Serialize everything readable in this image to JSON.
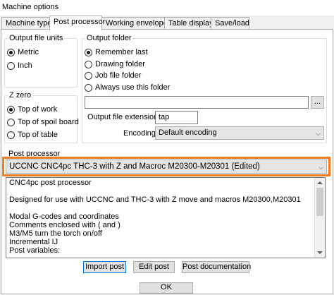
{
  "window": {
    "title": "Machine options"
  },
  "tabs": [
    {
      "label": "Machine type"
    },
    {
      "label": "Post processor"
    },
    {
      "label": "Working envelope"
    },
    {
      "label": "Table display"
    },
    {
      "label": "Save/load"
    }
  ],
  "output_units": {
    "legend": "Output file units",
    "options": [
      {
        "label": "Metric",
        "selected": true
      },
      {
        "label": "Inch",
        "selected": false
      }
    ]
  },
  "z_zero": {
    "legend": "Z zero",
    "options": [
      {
        "label": "Top of work",
        "selected": true
      },
      {
        "label": "Top of spoil board",
        "selected": false
      },
      {
        "label": "Top of table",
        "selected": false
      }
    ]
  },
  "output_folder": {
    "legend": "Output folder",
    "options": [
      {
        "label": "Remember last",
        "selected": true
      },
      {
        "label": "Drawing folder",
        "selected": false
      },
      {
        "label": "Job file folder",
        "selected": false
      },
      {
        "label": "Always use this folder",
        "selected": false
      }
    ],
    "path_value": "",
    "browse_label": "...",
    "extension_label": "Output file extension",
    "extension_value": "tap",
    "encoding_label": "Encoding",
    "encoding_value": "Default encoding"
  },
  "post_processor": {
    "legend": "Post processor",
    "selected": "UCCNC  CNC4pc THC-3 with Z and Macroc M20300-M20301 (Edited)",
    "description_lines": [
      "CNC4pc  post processor",
      "",
      "Designed for use with UCCNC and THC-3 with Z move and macros M20300,M20301",
      "",
      "Modal G-codes and coordinates",
      "Comments enclosed with ( and )",
      "M3/M5 turn the torch on/off",
      "Incremental IJ",
      "Post variables:"
    ],
    "import_label": "Import post",
    "edit_label": "Edit post",
    "docs_label": "Post documentation"
  },
  "ok_label": "OK",
  "colors": {
    "highlight": "#f07c1e"
  }
}
